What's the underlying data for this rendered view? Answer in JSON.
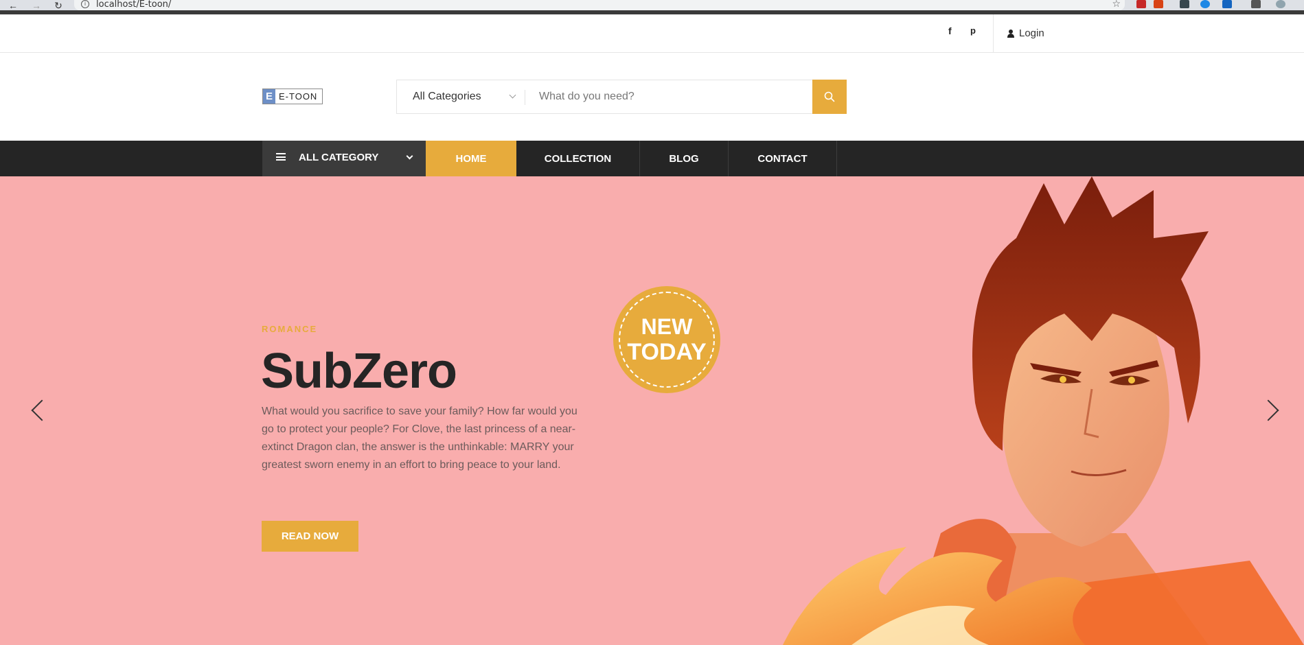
{
  "browser": {
    "url": "localhost/E-toon/"
  },
  "topbar": {
    "social": [
      "f",
      "p"
    ],
    "login_label": "Login"
  },
  "header": {
    "logo_letter": "E",
    "logo_text": "E-TOON",
    "search": {
      "category_value": "All Categories",
      "placeholder": "What do you need?"
    }
  },
  "nav": {
    "all_category": "ALL CATEGORY",
    "items": [
      {
        "label": "HOME",
        "active": true
      },
      {
        "label": "COLLECTION",
        "active": false
      },
      {
        "label": "BLOG",
        "active": false
      },
      {
        "label": "CONTACT",
        "active": false
      }
    ]
  },
  "hero": {
    "category": "ROMANCE",
    "title": "SubZero",
    "description": "What would you sacrifice to save your family? How far would you go to protect your people? For Clove, the last princess of a near-extinct Dragon clan, the answer is the unthinkable: MARRY your greatest sworn enemy in an effort to bring peace to your land.",
    "button": "READ NOW",
    "badge_line1": "NEW",
    "badge_line2": "TODAY"
  },
  "colors": {
    "accent": "#e7ab3c",
    "hero_bg": "#f9adad",
    "nav_bg": "#252525"
  }
}
